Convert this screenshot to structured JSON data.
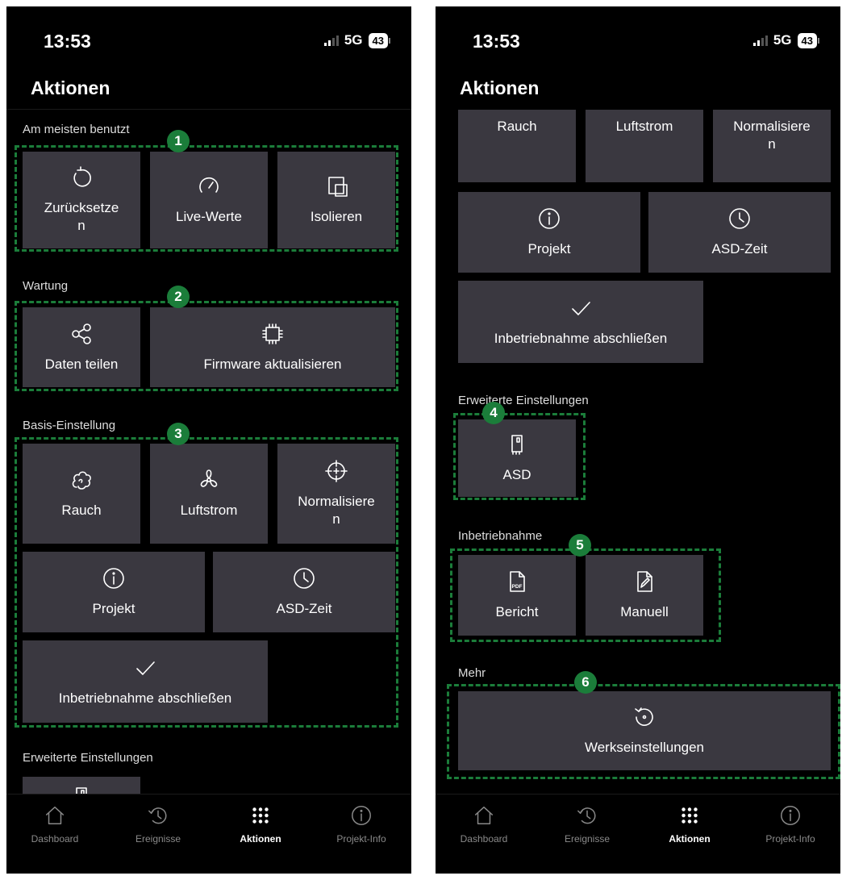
{
  "status": {
    "time": "13:53",
    "network": "5G",
    "battery": "43"
  },
  "app": {
    "title": "Aktionen"
  },
  "sections": {
    "meist": "Am meisten benutzt",
    "wartung": "Wartung",
    "basis": "Basis-Einstellung",
    "erweitert": "Erweiterte Einstellungen",
    "inbetrieb": "Inbetriebnahme",
    "mehr": "Mehr"
  },
  "tiles": {
    "zuruecksetzen": "Zurücksetze\nn",
    "live": "Live-Werte",
    "isolieren": "Isolieren",
    "daten": "Daten teilen",
    "firmware": "Firmware aktualisieren",
    "rauch": "Rauch",
    "luftstrom": "Luftstrom",
    "normalisieren": "Normalisiere\nn",
    "projekt": "Projekt",
    "asdzeit": "ASD-Zeit",
    "abschliessen": "Inbetriebnahme abschließen",
    "asd": "ASD",
    "bericht": "Bericht",
    "manuell": "Manuell",
    "werks": "Werkseinstellungen"
  },
  "callouts": [
    "1",
    "2",
    "3",
    "4",
    "5",
    "6"
  ],
  "tabs": [
    "Dashboard",
    "Ereignisse",
    "Aktionen",
    "Projekt-Info"
  ],
  "colors": {
    "background": "#000000",
    "tile": "#3a3840",
    "callout": "#1b7d3a",
    "tab_inactive": "#8a8a8a"
  }
}
